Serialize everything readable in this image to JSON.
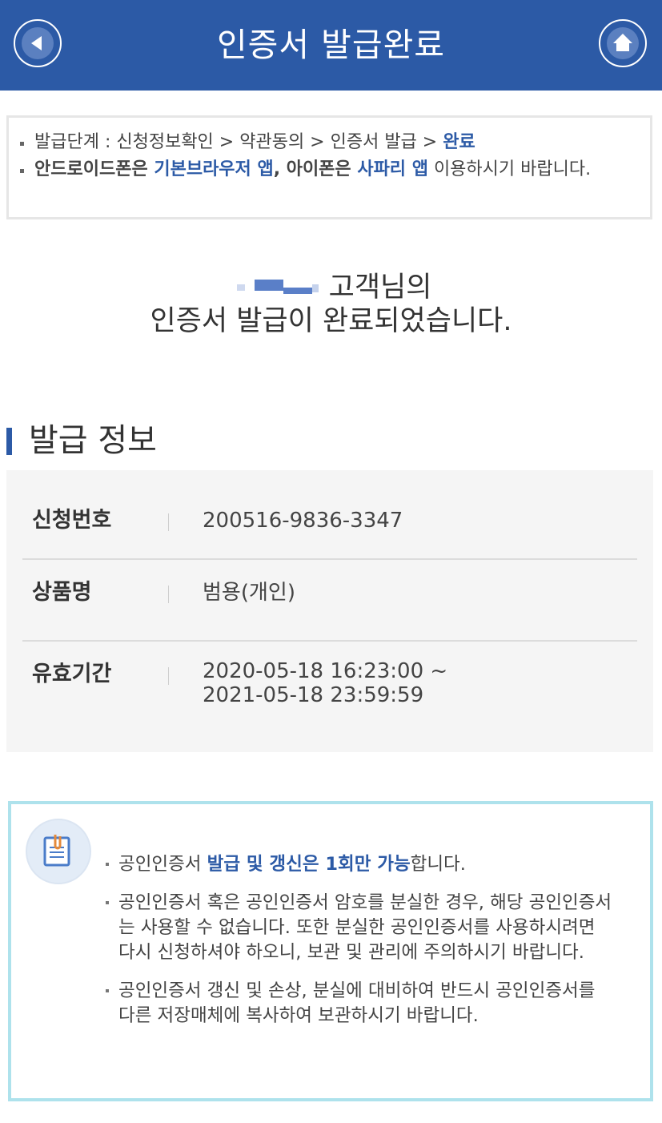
{
  "header": {
    "title": "인증서 발급완료",
    "back_icon": "back-arrow-icon",
    "home_icon": "home-icon",
    "color": "#2c5aa6"
  },
  "notice": {
    "steps_label": "발급단계 : 신청정보확인 > 약관동의 > 인증서 발급 > ",
    "steps_current": "완료",
    "browser_a": "안드로이드폰은 ",
    "browser_b": "기본브라우저 앱",
    "browser_c": ", 아이폰은 ",
    "browser_d": "사파리 앱",
    "browser_e": " 이용하시기 바랍니다."
  },
  "message": {
    "line1_suffix": " 고객님의",
    "line2": "인증서 발급이 완료되었습니다."
  },
  "issue_info": {
    "title": "발급 정보",
    "rows": [
      {
        "label": "신청번호",
        "value": "200516-9836-3347"
      },
      {
        "label": "상품명",
        "value": "범용(개인)"
      },
      {
        "label": "유효기간",
        "value_start": "2020-05-18 16:23:00 ~",
        "value_end": "2021-05-18 23:59:59"
      }
    ]
  },
  "guide": {
    "icon": "notepad-clip-icon",
    "item1_a": "공인인증서 ",
    "item1_b": "발급 및 갱신은 1회만 가능",
    "item1_c": "합니다.",
    "item2": "공인인증서 혹은 공인인증서 암호를 분실한 경우, 해당 공인인증서는 사용할 수 없습니다. 또한 분실한 공인인증서를 사용하시려면 다시 신청하셔야 하오니, 보관 및 관리에 주의하시기 바랍니다.",
    "item3": "공인인증서 갱신 및 손상, 분실에 대비하여 반드시 공인인증서를 다른 저장매체에 복사하여 보관하시기 바랍니다."
  }
}
